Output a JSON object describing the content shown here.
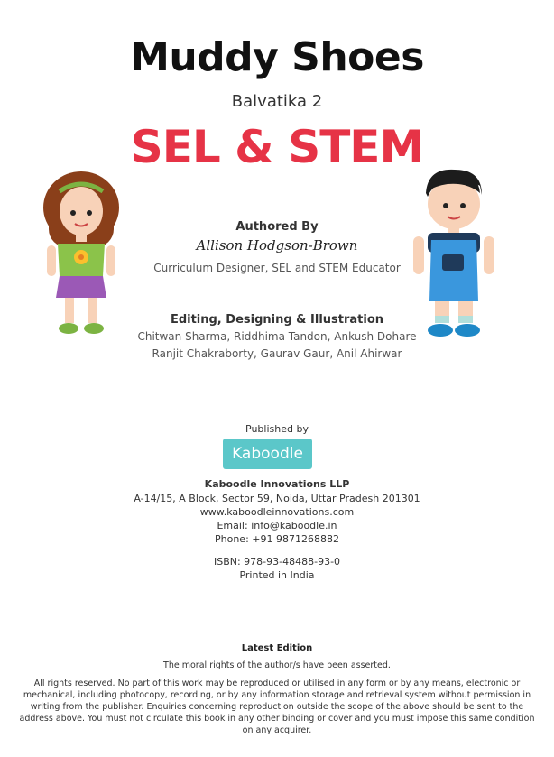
{
  "book": {
    "title": "Muddy Shoes",
    "subtitle": "Balvatika 2",
    "series": "SEL & STEM"
  },
  "authored": {
    "heading": "Authored By",
    "name": "Allison Hodgson-Brown",
    "role": "Curriculum Designer, SEL and STEM Educator"
  },
  "editing": {
    "heading": "Editing, Designing & Illustration",
    "line1": "Chitwan Sharma, Riddhima Tandon, Ankush Dohare",
    "line2": "Ranjit Chakraborty, Gaurav Gaur, Anil Ahirwar"
  },
  "publisher": {
    "heading": "Published by",
    "logo_text": "Kaboodle",
    "name": "Kaboodle Innovations LLP",
    "address": "A-14/15, A Block, Sector 59, Noida, Uttar Pradesh 201301",
    "website": "www.kaboodleinnovations.com",
    "email": "Email: info@kaboodle.in",
    "phone": "Phone: +91 9871268882",
    "isbn": "ISBN: 978-93-48488-93-0",
    "printed": "Printed in India"
  },
  "legal": {
    "edition": "Latest Edition",
    "moral_rights": "The moral rights of the author/s have been asserted.",
    "rights": "All rights reserved. No part of this work may be reproduced or utilised in any form or by any means, electronic or mechanical, including photocopy, recording, or by any information storage and retrieval system without permission in writing from the publisher. Enquiries concerning reproduction outside the scope of the above should be sent to the address above. You must not circulate this book in any other binding or cover and you must impose this same condition on any acquirer."
  },
  "colors": {
    "accent_red": "#e63346",
    "logo_teal": "#5bc7c9"
  },
  "icons": {
    "girl": "girl-illustration",
    "boy": "boy-illustration"
  }
}
